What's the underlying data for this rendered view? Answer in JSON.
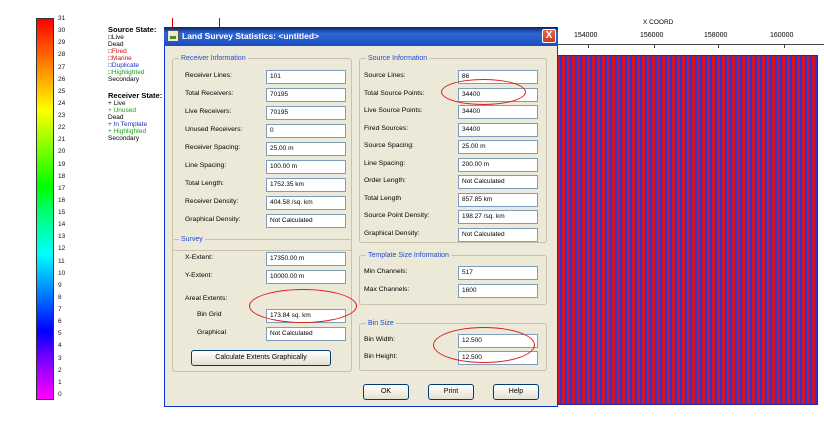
{
  "color_scale": {
    "labels": [
      "31",
      "30",
      "29",
      "28",
      "27",
      "26",
      "25",
      "24",
      "23",
      "22",
      "21",
      "20",
      "19",
      "18",
      "17",
      "16",
      "15",
      "14",
      "13",
      "12",
      "11",
      "10",
      "9",
      "8",
      "7",
      "6",
      "5",
      "4",
      "3",
      "2",
      "1",
      "0"
    ]
  },
  "legend": {
    "source_title": "Source State:",
    "source_items": [
      {
        "label": "□Live",
        "color": "#000000"
      },
      {
        "label": " Dead",
        "color": "#000000"
      },
      {
        "label": "□Fired",
        "color": "#d01010"
      },
      {
        "label": "□Marine",
        "color": "#d01010"
      },
      {
        "label": "□Duplicate",
        "color": "#2030c0"
      },
      {
        "label": "□Highlighted",
        "color": "#18a018"
      },
      {
        "label": " Secondary",
        "color": "#000000"
      }
    ],
    "receiver_title": "Receiver State:",
    "receiver_items": [
      {
        "label": "+ Live",
        "color": "#000000"
      },
      {
        "label": "+ Unused",
        "color": "#18a018"
      },
      {
        "label": " Dead",
        "color": "#000000"
      },
      {
        "label": "+ In Template",
        "color": "#2030c0"
      },
      {
        "label": "+ Highlighted",
        "color": "#18a018"
      },
      {
        "label": " Secondary",
        "color": "#000000"
      }
    ]
  },
  "map": {
    "x_coord_label": "X COORD",
    "ticks": [
      "154000",
      "156000",
      "158000",
      "160000"
    ]
  },
  "dialog": {
    "title": "Land Survey Statistics: <untitled>",
    "close_label": "X",
    "receiver": {
      "title": "Receiver Information",
      "rows": [
        {
          "label": "Receiver Lines:",
          "value": "101"
        },
        {
          "label": "Total Receivers:",
          "value": "70195"
        },
        {
          "label": "Live Receivers:",
          "value": "70195"
        },
        {
          "label": "Unused Receivers:",
          "value": "0"
        },
        {
          "label": "Receiver Spacing:",
          "value": "25.00 m"
        },
        {
          "label": "Line Spacing:",
          "value": "100.00 m"
        },
        {
          "label": "Total Length:",
          "value": "1752.35 km"
        },
        {
          "label": "Receiver Density:",
          "value": "404.58 /sq. km"
        },
        {
          "label": "Graphical Density:",
          "value": "Not Calculated"
        }
      ]
    },
    "source": {
      "title": "Source Information",
      "rows": [
        {
          "label": "Source Lines:",
          "value": "86"
        },
        {
          "label": "Total Source Points:",
          "value": "34400"
        },
        {
          "label": "Live Source Points:",
          "value": "34400"
        },
        {
          "label": "Fired Sources:",
          "value": "34400"
        },
        {
          "label": "Source Spacing:",
          "value": "25.00 m"
        },
        {
          "label": "Line Spacing:",
          "value": "200.00 m"
        },
        {
          "label": "Order Length:",
          "value": "Not Calculated"
        },
        {
          "label": "Total Length",
          "value": "857.85 km"
        },
        {
          "label": "Source Point Density:",
          "value": "198.27 /sq. km"
        },
        {
          "label": "Graphical Density:",
          "value": "Not Calculated"
        }
      ]
    },
    "survey": {
      "title": "Survey",
      "x_extent_label": "X-Extent:",
      "x_extent_value": "17350.00 m",
      "y_extent_label": "Y-Extent:",
      "y_extent_value": "10000.00 m",
      "areal_label": "Areal Extents:",
      "bin_grid_label": "Bin Grid",
      "bin_grid_value": "173.84 sq. km",
      "graphical_label": "Graphical",
      "graphical_value": "Not Calculated",
      "calc_button": "Calculate Extents Graphically"
    },
    "template": {
      "title": "Template Size Information",
      "min_label": "Min Channels:",
      "min_value": "517",
      "max_label": "Max Channels:",
      "max_value": "1600"
    },
    "bin": {
      "title": "Bin Size",
      "width_label": "Bin Width:",
      "width_value": "12.500",
      "height_label": "Bin Height:",
      "height_value": "12.500"
    },
    "buttons": {
      "ok": "OK",
      "print": "Print",
      "help": "Help"
    }
  }
}
